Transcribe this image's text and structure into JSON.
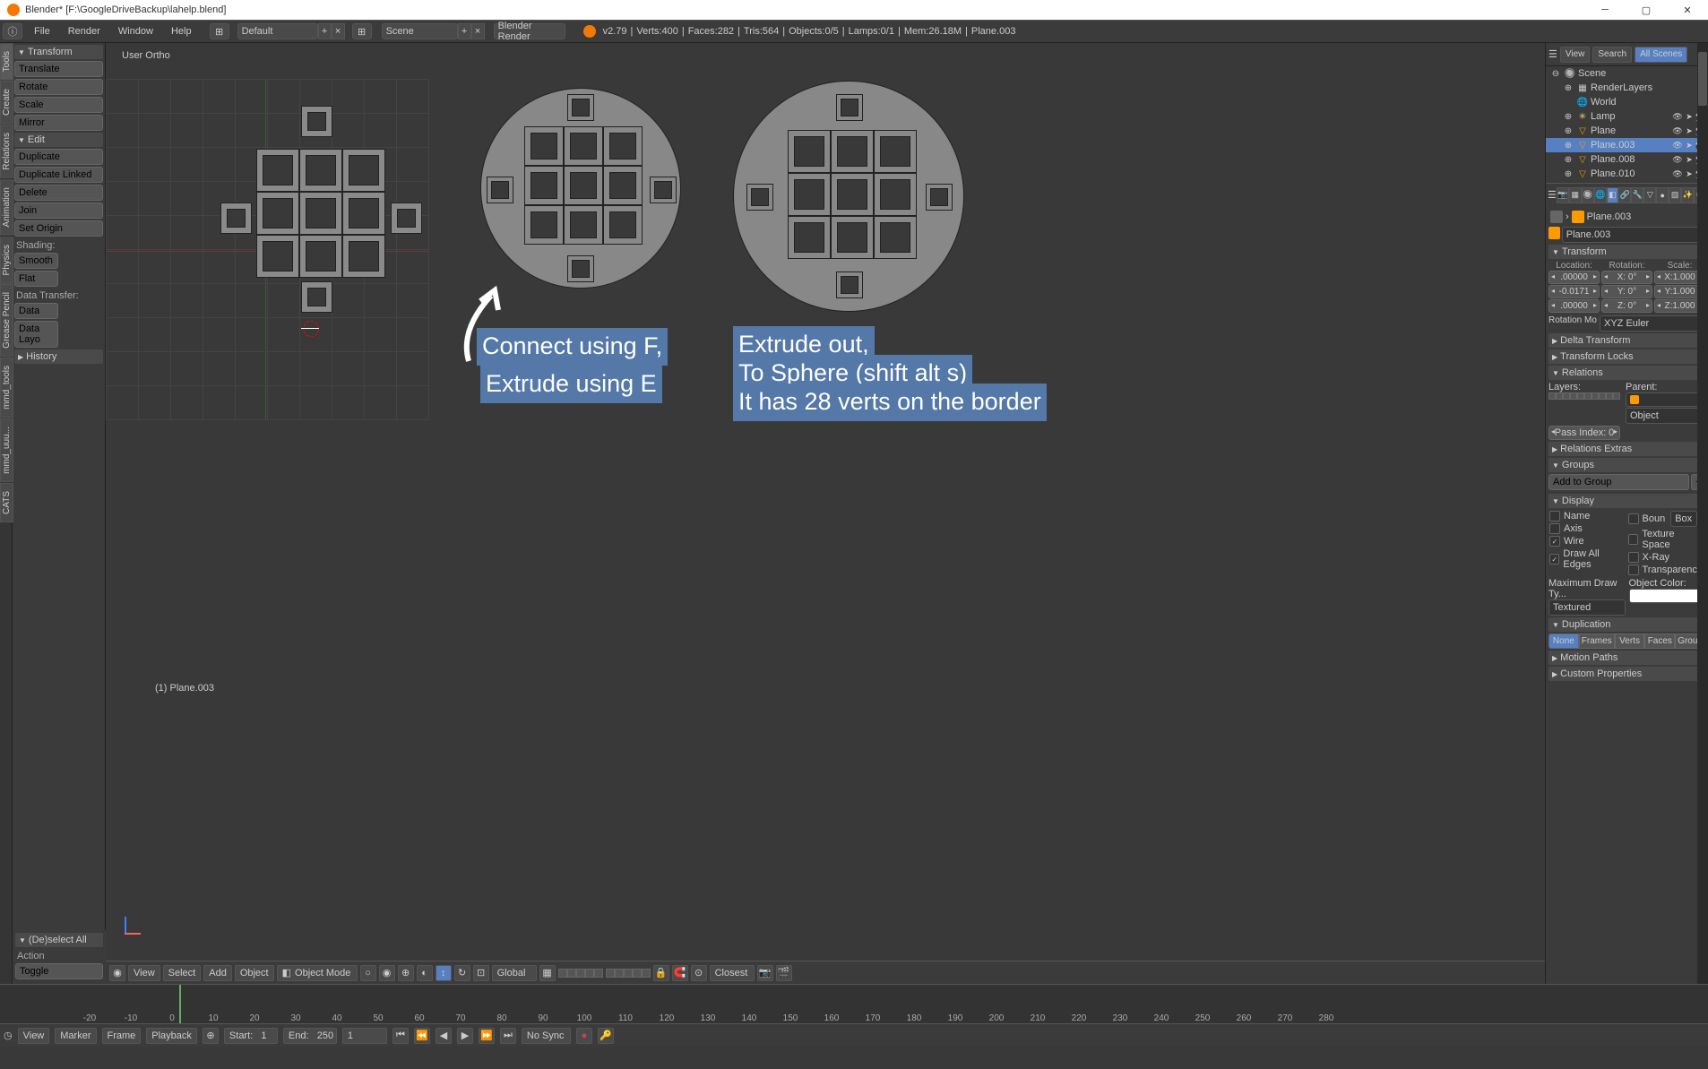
{
  "window": {
    "title": "Blender* [F:\\GoogleDriveBackup\\lahelp.blend]"
  },
  "topmenu": {
    "file": "File",
    "render": "Render",
    "window": "Window",
    "help": "Help"
  },
  "layout": {
    "name": "Default"
  },
  "scene": {
    "name": "Scene"
  },
  "engine": {
    "name": "Blender Render"
  },
  "stats": {
    "version": "v2.79",
    "verts": "Verts:400",
    "faces": "Faces:282",
    "tris": "Tris:564",
    "objects": "Objects:0/5",
    "lamps": "Lamps:0/1",
    "mem": "Mem:26.18M",
    "obj": "Plane.003"
  },
  "vtabs": {
    "tools": "Tools",
    "create": "Create",
    "relations": "Relations",
    "animation": "Animation",
    "physics": "Physics",
    "grease": "Grease Pencil",
    "mmd": "mmd_tools",
    "mmd2": "mmd_uuu...",
    "cats": "CATS"
  },
  "toolpanel": {
    "transform_hdr": "Transform",
    "translate": "Translate",
    "rotate": "Rotate",
    "scale": "Scale",
    "mirror": "Mirror",
    "edit_hdr": "Edit",
    "duplicate": "Duplicate",
    "dup_linked": "Duplicate Linked",
    "delete": "Delete",
    "join": "Join",
    "set_origin": "Set Origin",
    "shading_lbl": "Shading:",
    "smooth": "Smooth",
    "flat": "Flat",
    "data_lbl": "Data Transfer:",
    "data": "Data",
    "data_layo": "Data Layo",
    "history_hdr": "History"
  },
  "viewport": {
    "label": "User Ortho",
    "obj_label": "(1) Plane.003",
    "anno1_l1": "Connect using F,",
    "anno1_l2": "Extrude using E",
    "anno2_l1": "Extrude out,",
    "anno2_l2": "To Sphere (shift alt s)",
    "anno2_l3": "It has 28 verts on the border"
  },
  "vp_header": {
    "view": "View",
    "select": "Select",
    "add": "Add",
    "object": "Object",
    "mode": "Object Mode",
    "global": "Global",
    "closest": "Closest"
  },
  "op_panel": {
    "hdr": "(De)select All",
    "action_lbl": "Action",
    "toggle": "Toggle"
  },
  "outliner_hdr": {
    "view": "View",
    "search": "Search",
    "all": "All Scenes"
  },
  "outliner": {
    "scene": "Scene",
    "renderlayers": "RenderLayers",
    "world": "World",
    "lamp": "Lamp",
    "plane": "Plane",
    "plane003": "Plane.003",
    "plane008": "Plane.008",
    "plane010": "Plane.010"
  },
  "props": {
    "breadcrumb_obj": "Plane.003",
    "name_input": "Plane.003",
    "transform_hdr": "Transform",
    "loc_lbl": "Location:",
    "rot_lbl": "Rotation:",
    "scale_lbl": "Scale:",
    "loc_x": ".00000",
    "loc_y": "-0.0171",
    "loc_z": ".00000",
    "rot_x": "X:        0°",
    "rot_y": "Y:        0°",
    "rot_z": "Z:        0°",
    "scale_x": "X:1.000",
    "scale_y": "Y:1.000",
    "scale_z": "Z:1.000",
    "rot_mode_lbl": "Rotation Mo",
    "rot_mode": "XYZ Euler",
    "delta": "Delta Transform",
    "tlocks": "Transform Locks",
    "relations": "Relations",
    "layers_lbl": "Layers:",
    "parent_lbl": "Parent:",
    "parent_obj": "Object",
    "pass_lbl": "Pass Index:",
    "pass_val": "0",
    "rel_extras": "Relations Extras",
    "groups": "Groups",
    "add_group": "Add to Group",
    "display": "Display",
    "chk_name": "Name",
    "chk_boun": "Boun",
    "box": "Box",
    "chk_axis": "Axis",
    "chk_tex": "Texture Space",
    "chk_wire": "Wire",
    "chk_xray": "X-Ray",
    "chk_draw": "Draw All Edges",
    "chk_transp": "Transparency",
    "max_draw": "Maximum Draw Ty...",
    "obj_color": "Object Color:",
    "textured": "Textured",
    "duplication": "Duplication",
    "dup_none": "None",
    "dup_frames": "Frames",
    "dup_verts": "Verts",
    "dup_faces": "Faces",
    "dup_group": "Group",
    "motion": "Motion Paths",
    "custom": "Custom Properties"
  },
  "timeline": {
    "view": "View",
    "marker": "Marker",
    "frame": "Frame",
    "playback": "Playback",
    "start_lbl": "Start:",
    "start": "1",
    "end_lbl": "End:",
    "end": "250",
    "current": "1",
    "sync": "No Sync",
    "ticks": [
      "-20",
      "-10",
      "0",
      "10",
      "20",
      "30",
      "40",
      "50",
      "60",
      "70",
      "80",
      "90",
      "100",
      "110",
      "120",
      "130",
      "140",
      "150",
      "160",
      "170",
      "180",
      "190",
      "200",
      "210",
      "220",
      "230",
      "240",
      "250",
      "260",
      "270",
      "280"
    ]
  }
}
